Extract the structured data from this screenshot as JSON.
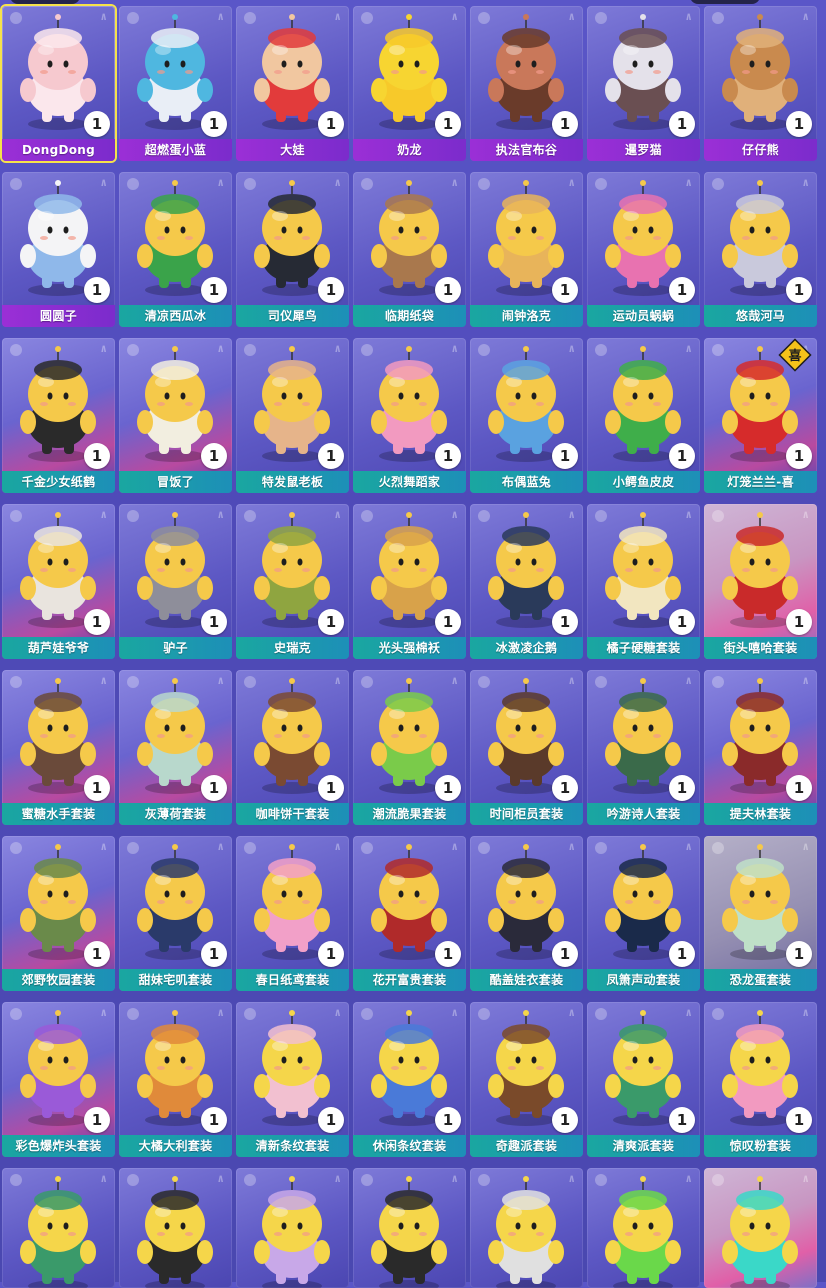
{
  "items": [
    {
      "name": "DongDong",
      "count": "1",
      "bar": "purple",
      "bg": "",
      "selected": true,
      "body": "#f6c9cf",
      "accent": "#fbe7ec",
      "icon": "sheep-character-icon"
    },
    {
      "name": "超燃蛋小蓝",
      "count": "1",
      "bar": "purple",
      "bg": "",
      "body": "#4fb7e0",
      "accent": "#e9eef6",
      "icon": "headphone-character-icon"
    },
    {
      "name": "大娃",
      "count": "1",
      "bar": "purple",
      "bg": "",
      "body": "#f1c7a0",
      "accent": "#e23b3b",
      "icon": "gourd-boy-icon"
    },
    {
      "name": "奶龙",
      "count": "1",
      "bar": "purple",
      "bg": "",
      "body": "#f7d531",
      "accent": "#f7c92a",
      "icon": "yellow-dragon-icon"
    },
    {
      "name": "执法官布谷",
      "count": "1",
      "bar": "purple",
      "bg": "",
      "body": "#c9785a",
      "accent": "#6a3b2a",
      "icon": "officer-girl-icon"
    },
    {
      "name": "暹罗猫",
      "count": "1",
      "bar": "purple",
      "bg": "",
      "body": "#e4e1ea",
      "accent": "#6a4f52",
      "icon": "siamese-cat-icon"
    },
    {
      "name": "仔仔熊",
      "count": "1",
      "bar": "purple",
      "bg": "",
      "body": "#c98a4e",
      "accent": "#e0b07a",
      "icon": "bear-icon"
    },
    {
      "name": "圆圆子",
      "count": "1",
      "bar": "purple",
      "bg": "",
      "body": "#f4f4f6",
      "accent": "#8fb8ea",
      "icon": "white-seal-icon"
    },
    {
      "name": "清凉西瓜冰",
      "count": "1",
      "bar": "teal",
      "bg": "",
      "body": "#f5c94a",
      "accent": "#3aa34a",
      "icon": "watermelon-egg-icon"
    },
    {
      "name": "司仪犀鸟",
      "count": "1",
      "bar": "teal",
      "bg": "",
      "body": "#f5c94a",
      "accent": "#262a34",
      "icon": "hornbill-egg-icon"
    },
    {
      "name": "临期纸袋",
      "count": "1",
      "bar": "teal",
      "bg": "",
      "body": "#f5c94a",
      "accent": "#a9784d",
      "icon": "paper-bag-egg-icon"
    },
    {
      "name": "闹钟洛克",
      "count": "1",
      "bar": "teal",
      "bg": "",
      "body": "#f5c94a",
      "accent": "#e8b45a",
      "icon": "alarm-clock-egg-icon"
    },
    {
      "name": "运动员蜗蜗",
      "count": "1",
      "bar": "teal",
      "bg": "",
      "body": "#f5c94a",
      "accent": "#e872b0",
      "icon": "snail-athlete-egg-icon"
    },
    {
      "name": "悠哉河马",
      "count": "1",
      "bar": "teal",
      "bg": "",
      "body": "#f5c94a",
      "accent": "#c9c9dc",
      "icon": "hippo-egg-icon"
    },
    {
      "name": "千金少女纸鹤",
      "count": "1",
      "bar": "teal",
      "bg": "bg-stage",
      "body": "#f5c94a",
      "accent": "#2a2a2a",
      "icon": "paper-crane-egg-icon"
    },
    {
      "name": "冒饭了",
      "count": "1",
      "bar": "teal",
      "bg": "bg-stage",
      "body": "#f5c94a",
      "accent": "#f2eee0",
      "icon": "rice-bowl-egg-icon"
    },
    {
      "name": "特发鼠老板",
      "count": "1",
      "bar": "teal",
      "bg": "",
      "body": "#f5c94a",
      "accent": "#e6b48a",
      "icon": "mouse-boss-egg-icon"
    },
    {
      "name": "火烈舞蹈家",
      "count": "1",
      "bar": "teal",
      "bg": "",
      "body": "#f5c94a",
      "accent": "#f29ac0",
      "icon": "flamingo-egg-icon"
    },
    {
      "name": "布偶蓝兔",
      "count": "1",
      "bar": "teal",
      "bg": "",
      "body": "#f5c94a",
      "accent": "#5aa2e0",
      "icon": "blue-rabbit-egg-icon"
    },
    {
      "name": "小鳄鱼皮皮",
      "count": "1",
      "bar": "teal",
      "bg": "",
      "body": "#f5c94a",
      "accent": "#3fae4a",
      "icon": "crocodile-egg-icon"
    },
    {
      "name": "灯笼兰兰-喜",
      "count": "1",
      "bar": "teal",
      "bg": "bg-stage",
      "body": "#f5c94a",
      "accent": "#d62b2b",
      "icon": "lantern-egg-icon",
      "sign": "喜"
    },
    {
      "name": "葫芦娃爷爷",
      "count": "1",
      "bar": "teal",
      "bg": "bg-stage",
      "body": "#f5c94a",
      "accent": "#e9e4de",
      "icon": "grandpa-egg-icon"
    },
    {
      "name": "驴子",
      "count": "1",
      "bar": "teal",
      "bg": "",
      "body": "#f5c94a",
      "accent": "#8e8e9a",
      "icon": "donkey-egg-icon"
    },
    {
      "name": "史瑞克",
      "count": "1",
      "bar": "teal",
      "bg": "",
      "body": "#f5c94a",
      "accent": "#8fa540",
      "icon": "ogre-egg-icon"
    },
    {
      "name": "光头强棉袄",
      "count": "1",
      "bar": "teal",
      "bg": "",
      "body": "#f5c94a",
      "accent": "#d8a24a",
      "icon": "winter-hat-egg-icon"
    },
    {
      "name": "冰激凌企鹅",
      "count": "1",
      "bar": "teal",
      "bg": "",
      "body": "#f5c94a",
      "accent": "#2a3a5a",
      "icon": "penguin-egg-icon"
    },
    {
      "name": "橘子硬糖套装",
      "count": "1",
      "bar": "teal",
      "bg": "",
      "body": "#f5c94a",
      "accent": "#f2e6c0",
      "icon": "orange-candy-egg-icon"
    },
    {
      "name": "街头嘻哈套装",
      "count": "1",
      "bar": "teal",
      "bg": "bg-pink",
      "body": "#f5c94a",
      "accent": "#c92a2a",
      "icon": "hiphop-egg-icon"
    },
    {
      "name": "蜜糖水手套装",
      "count": "1",
      "bar": "teal",
      "bg": "bg-stage",
      "body": "#f5c94a",
      "accent": "#6a4a3a",
      "icon": "sailor-egg-icon"
    },
    {
      "name": "灰薄荷套装",
      "count": "1",
      "bar": "teal",
      "bg": "bg-stage",
      "body": "#f5c94a",
      "accent": "#b8d8cc",
      "icon": "mint-egg-icon"
    },
    {
      "name": "咖啡饼干套装",
      "count": "1",
      "bar": "teal",
      "bg": "",
      "body": "#f5c94a",
      "accent": "#7a4a32",
      "icon": "coffee-egg-icon"
    },
    {
      "name": "潮流脆果套装",
      "count": "1",
      "bar": "teal",
      "bg": "",
      "body": "#f5c94a",
      "accent": "#7acb4a",
      "icon": "fruit-egg-icon"
    },
    {
      "name": "时间柜员套装",
      "count": "1",
      "bar": "teal",
      "bg": "",
      "body": "#f5c94a",
      "accent": "#5a3a2a",
      "icon": "clerk-egg-icon"
    },
    {
      "name": "吟游诗人套装",
      "count": "1",
      "bar": "teal",
      "bg": "",
      "body": "#f5c94a",
      "accent": "#3a6a4a",
      "icon": "bard-egg-icon"
    },
    {
      "name": "提夫林套装",
      "count": "1",
      "bar": "teal",
      "bg": "bg-stage",
      "body": "#f5c94a",
      "accent": "#8a2a2a",
      "icon": "tiefling-egg-icon"
    },
    {
      "name": "郊野牧园套装",
      "count": "1",
      "bar": "teal",
      "bg": "bg-stage",
      "body": "#f5c94a",
      "accent": "#6a8a4a",
      "icon": "farm-egg-icon"
    },
    {
      "name": "甜妹宅叽套装",
      "count": "1",
      "bar": "teal",
      "bg": "",
      "body": "#f5c94a",
      "accent": "#2a3a6a",
      "icon": "sweet-girl-egg-icon"
    },
    {
      "name": "春日纸鸢套装",
      "count": "1",
      "bar": "teal",
      "bg": "",
      "body": "#f5c94a",
      "accent": "#f2a0c8",
      "icon": "kite-egg-icon"
    },
    {
      "name": "花开富贵套装",
      "count": "1",
      "bar": "teal",
      "bg": "",
      "body": "#f5c94a",
      "accent": "#b02a2a",
      "icon": "flower-dress-egg-icon"
    },
    {
      "name": "酷盖娃衣套装",
      "count": "1",
      "bar": "teal",
      "bg": "",
      "body": "#f5c94a",
      "accent": "#2a2a3a",
      "icon": "cool-egg-icon"
    },
    {
      "name": "凤箫声动套装",
      "count": "1",
      "bar": "teal",
      "bg": "",
      "body": "#f5c94a",
      "accent": "#1a2a4a",
      "icon": "qing-hat-egg-icon"
    },
    {
      "name": "恐龙蛋套装",
      "count": "1",
      "bar": "teal",
      "bg": "bg-grey",
      "body": "#f5c94a",
      "accent": "#bfe0c8",
      "icon": "dino-egg-icon"
    },
    {
      "name": "彩色爆炸头套装",
      "count": "1",
      "bar": "teal",
      "bg": "bg-stage",
      "body": "#f5c94a",
      "accent": "#9a5ad8",
      "icon": "afro-egg-icon"
    },
    {
      "name": "大橘大利套装",
      "count": "1",
      "bar": "teal",
      "bg": "",
      "body": "#f5c94a",
      "accent": "#e08a3a",
      "icon": "orange-cat-egg-icon"
    },
    {
      "name": "清新条纹套装",
      "count": "1",
      "bar": "teal",
      "bg": "",
      "body": "#f5d64a",
      "accent": "#f2c0d0",
      "icon": "stripe-egg-icon"
    },
    {
      "name": "休闲条纹套装",
      "count": "1",
      "bar": "teal",
      "bg": "",
      "body": "#f5d64a",
      "accent": "#4a7ad8",
      "icon": "casual-stripe-egg-icon"
    },
    {
      "name": "奇趣派套装",
      "count": "1",
      "bar": "teal",
      "bg": "",
      "body": "#f5d64a",
      "accent": "#7a4a2a",
      "icon": "fun-egg-icon"
    },
    {
      "name": "清爽派套装",
      "count": "1",
      "bar": "teal",
      "bg": "",
      "body": "#f5d64a",
      "accent": "#3a9a6a",
      "icon": "fresh-egg-icon"
    },
    {
      "name": "惊叹粉套装",
      "count": "1",
      "bar": "teal",
      "bg": "",
      "body": "#f5d64a",
      "accent": "#f29ac0",
      "icon": "pink-egg-icon"
    }
  ],
  "partial_row": [
    {
      "body": "#f5d64a",
      "accent": "#3a9a6a",
      "bg": ""
    },
    {
      "body": "#f5d64a",
      "accent": "#2a2a2a",
      "bg": ""
    },
    {
      "body": "#f5d64a",
      "accent": "#c8a8e8",
      "bg": ""
    },
    {
      "body": "#f5d64a",
      "accent": "#2a2a2a",
      "bg": ""
    },
    {
      "body": "#f5d64a",
      "accent": "#e0e0e0",
      "bg": ""
    },
    {
      "body": "#f5d64a",
      "accent": "#6ad84a",
      "bg": ""
    },
    {
      "body": "#f5d64a",
      "accent": "#3ad8c8",
      "bg": "bg-pink"
    }
  ]
}
